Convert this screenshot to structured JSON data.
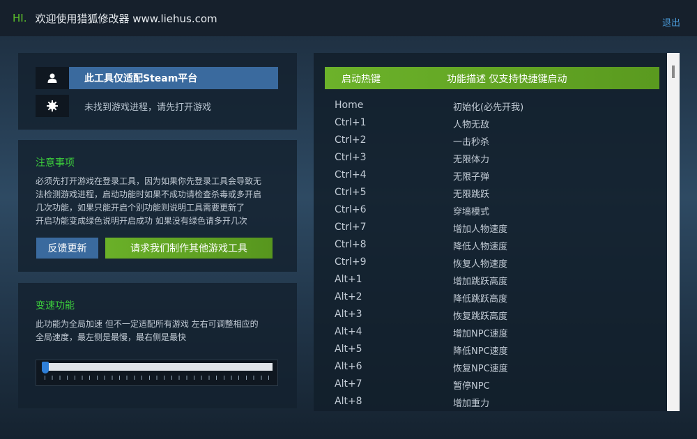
{
  "header": {
    "hi": "HI.",
    "welcome": "欢迎使用猎狐修改器 www.liehus.com",
    "logout": "退出"
  },
  "status_panel": {
    "platform_label": "此工具仅适配Steam平台",
    "process_status": "未找到游戏进程，请先打开游戏",
    "icons": [
      "user-icon",
      "gear-icon"
    ]
  },
  "notice_panel": {
    "title": "注意事项",
    "lines": [
      "必须先打开游戏在登录工具，因为如果你先登录工具会导致无",
      "法检测游戏进程，启动功能时如果不成功请检查杀毒或多开启",
      "几次功能，如果只能开启个别功能则说明工具需要更新了",
      "开启功能变成绿色说明开启成功 如果没有绿色请多开几次"
    ],
    "feedback_button": "反馈更新",
    "request_button": "请求我们制作其他游戏工具"
  },
  "speed_panel": {
    "title": "变速功能",
    "lines": [
      "此功能为全局加速 但不一定适配所有游戏 左右可调整相应的",
      "全局速度，最左侧是最慢，最右侧是最快"
    ],
    "slider_value": 0
  },
  "hotkey_table": {
    "col_hotkey": "启动热键",
    "col_desc": "功能描述 仅支持快捷键启动",
    "rows": [
      {
        "key": "Home",
        "desc": "初始化(必先开我)"
      },
      {
        "key": "Ctrl+1",
        "desc": "人物无敌"
      },
      {
        "key": "Ctrl+2",
        "desc": "一击秒杀"
      },
      {
        "key": "Ctrl+3",
        "desc": "无限体力"
      },
      {
        "key": "Ctrl+4",
        "desc": "无限子弹"
      },
      {
        "key": "Ctrl+5",
        "desc": "无限跳跃"
      },
      {
        "key": "Ctrl+6",
        "desc": "穿墙模式"
      },
      {
        "key": "Ctrl+7",
        "desc": "增加人物速度"
      },
      {
        "key": "Ctrl+8",
        "desc": "降低人物速度"
      },
      {
        "key": "Ctrl+9",
        "desc": "恢复人物速度"
      },
      {
        "key": "Alt+1",
        "desc": "增加跳跃高度"
      },
      {
        "key": "Alt+2",
        "desc": "降低跳跃高度"
      },
      {
        "key": "Alt+3",
        "desc": "恢复跳跃高度"
      },
      {
        "key": "Alt+4",
        "desc": "增加NPC速度"
      },
      {
        "key": "Alt+5",
        "desc": "降低NPC速度"
      },
      {
        "key": "Alt+6",
        "desc": "恢复NPC速度"
      },
      {
        "key": "Alt+7",
        "desc": "暂停NPC"
      },
      {
        "key": "Alt+8",
        "desc": "增加重力"
      }
    ]
  },
  "colors": {
    "accent_green": "#6cb22a",
    "accent_blue": "#3a6a9e",
    "title_green": "#3ccf3c"
  }
}
